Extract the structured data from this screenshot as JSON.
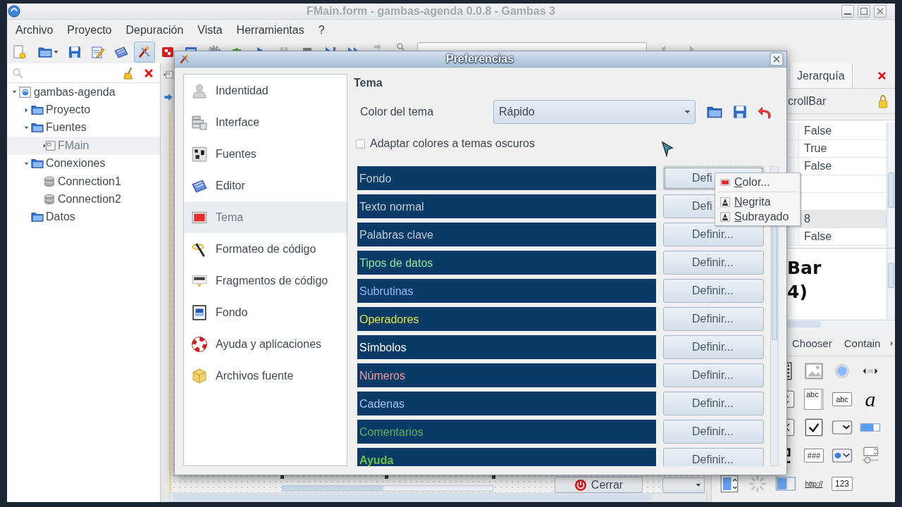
{
  "window": {
    "title": "FMain.form - gambas-agenda 0.0.8 - Gambas 3"
  },
  "menu": [
    "Archivo",
    "Proyecto",
    "Depuración",
    "Vista",
    "Herramientas",
    "?"
  ],
  "toolbar": [
    {
      "selected": false
    },
    {
      "selected": false
    },
    {
      "selected": false
    },
    {
      "selected": false
    },
    {
      "selected": false
    },
    {
      "selected": true
    },
    {
      "selected": false
    },
    {
      "selected": false
    },
    {
      "selected": false
    },
    {
      "selected": false
    },
    {
      "selected": false
    },
    {
      "selected": false
    },
    {
      "selected": false
    },
    {
      "selected": false
    },
    {
      "selected": false
    },
    {
      "selected": false
    },
    {
      "selected": false
    }
  ],
  "project_tree": [
    {
      "label": "gambas-agenda",
      "kind": "project",
      "expanded": true,
      "selected": false,
      "children": [
        {
          "label": "Proyecto",
          "kind": "folder",
          "expanded": false,
          "selected": false
        },
        {
          "label": "Fuentes",
          "kind": "folder",
          "expanded": true,
          "selected": false,
          "children": [
            {
              "label": "FMain",
              "kind": "form",
              "selected": true
            }
          ]
        },
        {
          "label": "Conexiones",
          "kind": "folder",
          "expanded": true,
          "selected": false,
          "children": [
            {
              "label": "Connection1",
              "kind": "connection",
              "selected": false
            },
            {
              "label": "Connection2",
              "kind": "connection",
              "selected": false
            }
          ]
        },
        {
          "label": "Datos",
          "kind": "folder",
          "selected": false
        }
      ]
    }
  ],
  "form_editor": {
    "button": "Cerrar"
  },
  "properties_panel": {
    "tab": "Jerarquía",
    "object": "crollBar",
    "rows": [
      {
        "value": "False",
        "selected": false
      },
      {
        "value": "True",
        "selected": false
      },
      {
        "value": "False",
        "selected": false
      },
      {
        "selected": false
      },
      {
        "selected": false
      },
      {
        "value": "8",
        "selected": true
      },
      {
        "value": "False",
        "selected": false
      }
    ],
    "preview": [
      "Bar",
      "4)"
    ]
  },
  "toolbox": {
    "tabs": [
      "Chooser",
      "Contain"
    ],
    "rows": [
      [
        "",
        "",
        {
          "kind": "filmstrip"
        },
        {
          "kind": "image"
        },
        {
          "kind": "radio"
        },
        {
          "kind": "scrollbar"
        }
      ],
      [
        "",
        "",
        {
          "kind": "spinbox"
        },
        {
          "kind": "textarea",
          "text": "abc"
        },
        {
          "kind": "textbox",
          "text": "abc"
        },
        {
          "kind": "label",
          "text": "a"
        }
      ],
      [
        "",
        "",
        {
          "kind": "xbox"
        },
        {
          "kind": "checkbox"
        },
        {
          "kind": "combo"
        },
        {
          "kind": "progress"
        }
      ],
      [
        "",
        "",
        {
          "kind": "lcd"
        },
        {
          "kind": "masked",
          "text": "###"
        },
        {
          "kind": "menubutton"
        },
        {
          "kind": "spinslider"
        }
      ],
      [
        {
          "kind": "colorspin"
        },
        {
          "kind": "spinner"
        },
        {
          "kind": "toggle"
        },
        {
          "kind": "link",
          "text": "http://"
        },
        {
          "kind": "valuebox",
          "text": "123"
        },
        ""
      ]
    ]
  },
  "dialog": {
    "title": "Preferencias",
    "sections": [
      {
        "label": "Indentidad",
        "selected": false
      },
      {
        "label": "Interface",
        "selected": false
      },
      {
        "label": "Fuentes",
        "selected": false
      },
      {
        "label": "Editor",
        "selected": false
      },
      {
        "label": "Tema",
        "selected": true
      },
      {
        "label": "Formateo de código",
        "selected": false
      },
      {
        "label": "Fragmentos de código",
        "selected": false
      },
      {
        "label": "Fondo",
        "selected": false
      },
      {
        "label": "Ayuda y aplicaciones",
        "selected": false
      },
      {
        "label": "Archivos fuente",
        "selected": false
      }
    ],
    "heading": "Tema",
    "theme": {
      "label": "Color del tema",
      "value": "Rápido"
    },
    "dark_adapt": {
      "label": "Adaptar colores a temas oscuros",
      "checked": false
    },
    "styles": [
      {
        "name": "Fondo",
        "color": "#c3ccd6",
        "bold": false,
        "button": "Defi",
        "focused": true
      },
      {
        "name": "Texto normal",
        "color": "#c9d0d7",
        "bold": false,
        "button": "Defi",
        "focused": false
      },
      {
        "name": "Palabras clave",
        "color": "#c0c9d3",
        "bold": false,
        "button": "Definir...",
        "focused": false
      },
      {
        "name": "Tipos de datos",
        "color": "#8fe6a4",
        "bold": false,
        "button": "Definir...",
        "focused": false
      },
      {
        "name": "Subrutinas",
        "color": "#93b9f6",
        "bold": false,
        "button": "Definir...",
        "focused": false
      },
      {
        "name": "Operadores",
        "color": "#dde440",
        "bold": false,
        "button": "Definir...",
        "focused": false
      },
      {
        "name": "Símbolos",
        "color": "#ffffff",
        "bold": false,
        "button": "Definir...",
        "focused": false
      },
      {
        "name": "Números",
        "color": "#f39a9a",
        "bold": false,
        "button": "Definir...",
        "focused": false
      },
      {
        "name": "Cadenas",
        "color": "#a6c2f2",
        "bold": false,
        "button": "Definir...",
        "focused": false
      },
      {
        "name": "Comentarios",
        "color": "#5db45d",
        "bold": false,
        "button": "Definir...",
        "focused": false
      },
      {
        "name": "Ayuda",
        "color": "#6cc04c",
        "bold": true,
        "button": "Definir...",
        "focused": false
      }
    ],
    "menu": [
      {
        "kind": "color",
        "label": "Color..."
      },
      {
        "kind": "separator"
      },
      {
        "kind": "format",
        "label": "Negrita"
      },
      {
        "kind": "format",
        "label": "Subrayado"
      }
    ]
  }
}
